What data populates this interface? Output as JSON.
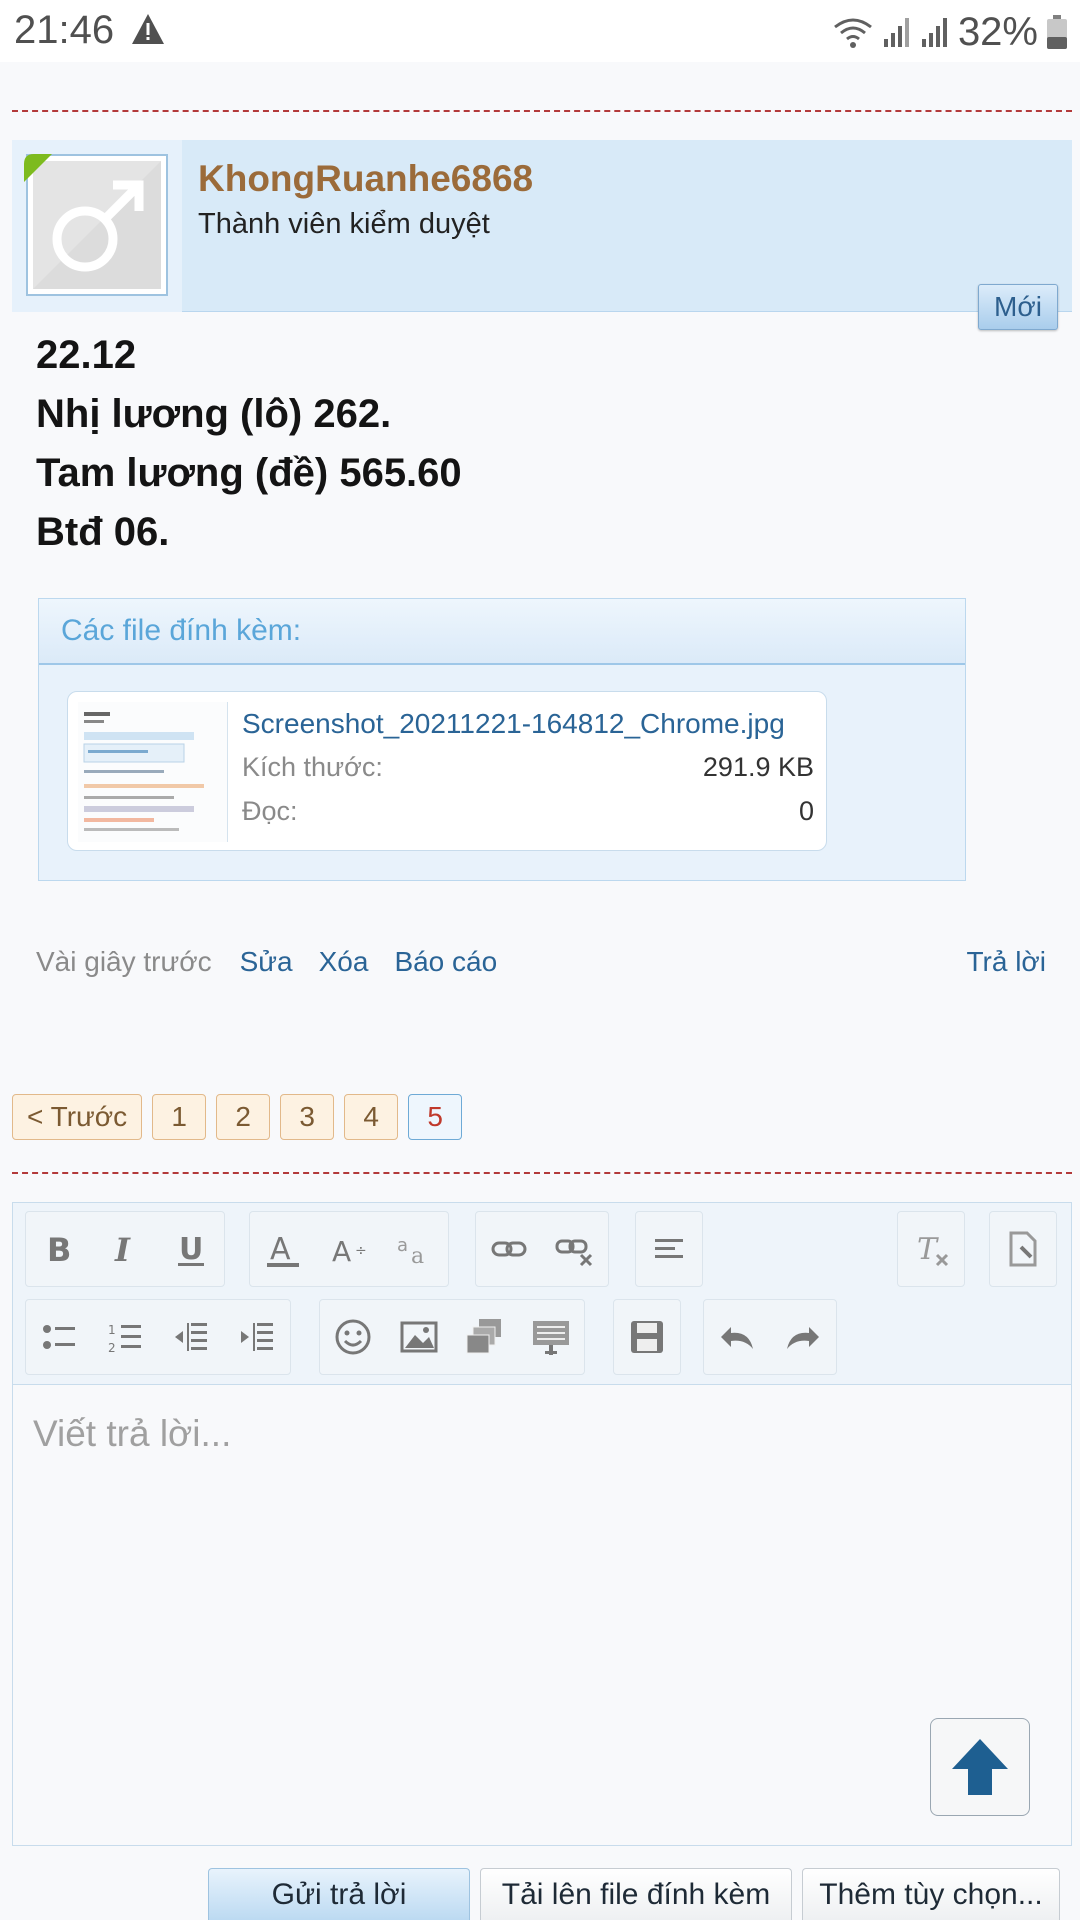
{
  "status_bar": {
    "time": "21:46",
    "battery": "32%",
    "icons": [
      "warning-icon",
      "wifi-icon",
      "signal-icon",
      "signal-icon",
      "battery-icon"
    ]
  },
  "post": {
    "username": "KhongRuanhe6868",
    "user_title": "Thành viên kiểm duyệt",
    "badge": "Mới",
    "lines": [
      "22.12",
      "Nhị lương (lô) 262.",
      "Tam lương (đề) 565.60",
      "Btđ 06."
    ],
    "attachments": {
      "title": "Các file đính kèm:",
      "file": {
        "name": "Screenshot_20211221-164812_Chrome.jpg",
        "size_label": "Kích thước:",
        "size_value": "291.9 KB",
        "views_label": "Đọc:",
        "views_value": "0"
      }
    },
    "actions": {
      "time": "Vài giây trước",
      "edit": "Sửa",
      "delete": "Xóa",
      "report": "Báo cáo",
      "reply": "Trả lời"
    }
  },
  "pagination": {
    "prev": "< Trước",
    "pages": [
      "1",
      "2",
      "3",
      "4",
      "5"
    ],
    "current": "5"
  },
  "editor": {
    "placeholder": "Viết trả lời..."
  },
  "buttons": {
    "send": "Gửi trả lời",
    "upload": "Tải lên file đính kèm",
    "more": "Thêm tùy chọn..."
  },
  "colors": {
    "username": "#9b6b3a",
    "link": "#2a6496",
    "header_bg": "#d8eaf8",
    "divider": "#b33a3a"
  }
}
